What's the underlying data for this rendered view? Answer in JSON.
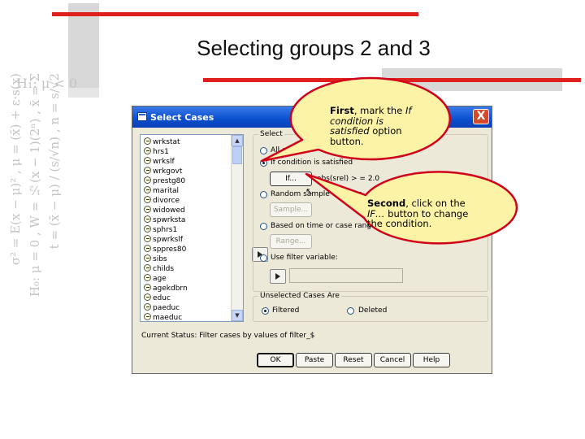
{
  "slide": {
    "title": "Selecting groups 2 and 3"
  },
  "background_math": {
    "top_fragment": "H₁: μ < 0",
    "columns": [
      "σ² = E(x − μ)² ,  μ = (x̄) + ε·s(x)",
      "H₀: μ = 0 ,  W = ½(x − 1)(2ⁿ) ,  x̄ = Σ",
      "t = (x̄ − μ) / (s/√n) ,  n = s/√2"
    ]
  },
  "dialog": {
    "title": "Select Cases",
    "close_label": "X",
    "variables": [
      "wrkstat",
      "hrs1",
      "wrkslf",
      "wrkgovt",
      "prestg80",
      "marital",
      "divorce",
      "widowed",
      "spwrksta",
      "sphrs1",
      "spwrkslf",
      "sppres80",
      "sibs",
      "childs",
      "age",
      "agekdbrn",
      "educ",
      "paeduc",
      "maeduc"
    ],
    "select_legend": "Select",
    "options": {
      "all_cases": "All cases",
      "if_condition": "If condition is satisfied",
      "random_sample": "Random sample of cases",
      "time_range": "Based on time or case range",
      "filter_variable": "Use filter variable:"
    },
    "buttons": {
      "if_button": "If...",
      "condition_text": "abs(srel) > = 2.0",
      "sample_button": "Sample...",
      "range_button": "Range..."
    },
    "unselected_legend": "Unselected Cases Are",
    "unselected_options": {
      "filtered": "Filtered",
      "deleted": "Deleted"
    },
    "status_text": "Current Status: Filter cases by values of filter_$",
    "footer_buttons": {
      "ok": "OK",
      "paste": "Paste",
      "reset": "Reset",
      "cancel": "Cancel",
      "help": "Help"
    }
  },
  "callouts": {
    "first": {
      "lead": "First",
      "text_1": ", mark the ",
      "em_1": "If condition is satisfied",
      "text_2": " option button."
    },
    "second": {
      "lead": "Second",
      "text_1": ", click on the ",
      "em_1": "IF…",
      "text_2": " button to change the condition."
    }
  },
  "colors": {
    "accent_red": "#e0201c",
    "callout_fill": "#fdf3a7",
    "callout_border": "#d0021b",
    "titlebar_blue": "#0a4fd0",
    "dialog_bg": "#ece9d8"
  }
}
